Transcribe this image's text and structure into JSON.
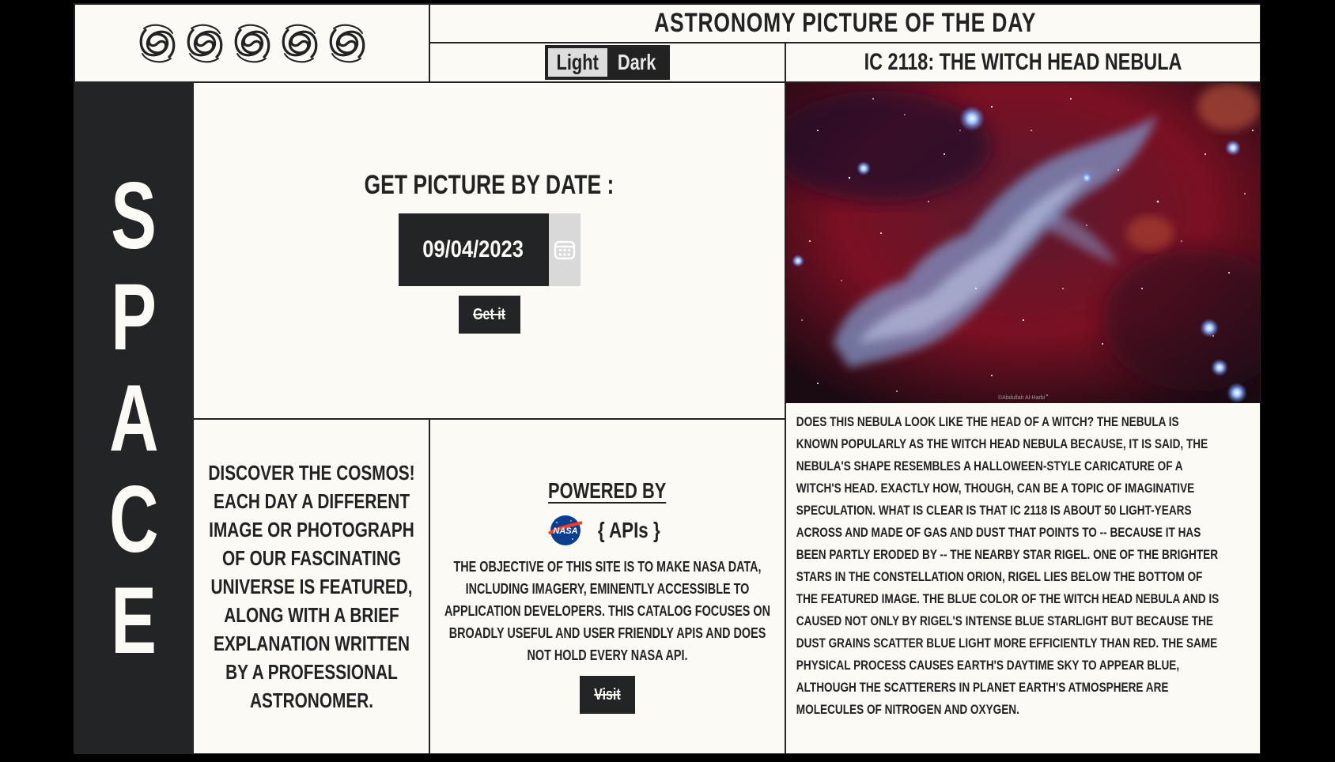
{
  "header": {
    "title": "Astronomy Picture of the Day",
    "logo_icons": [
      "galaxy-icon",
      "galaxy-icon",
      "galaxy-icon",
      "galaxy-icon",
      "galaxy-icon"
    ]
  },
  "theme_toggle": {
    "light_label": "Light",
    "dark_label": "Dark",
    "selected": "Light"
  },
  "picture": {
    "title": "IC 2118: The Witch Head Nebula",
    "credit": "©Abdullah Al-Harbi",
    "explanation": "Does this nebula look like the head of a witch? The nebula is known popularly as the Witch Head Nebula because, it is said, the nebula's shape resembles a Halloween-style caricature of a witch's head. Exactly how, though, can be a topic of imaginative speculation. What is clear is that IC 2118 is about 50 light-years across and made of gas and dust that points to -- because it has been partly eroded by -- the nearby star Rigel. One of the brighter stars in the constellation Orion, Rigel lies below the bottom of the featured image. The blue color of the Witch Head Nebula and is caused not only by Rigel's intense blue starlight but because the dust grains scatter blue light more efficiently than red. The same physical process causes Earth's daytime sky to appear blue, although the scatterers in planet Earth's atmosphere are molecules of nitrogen and oxygen."
  },
  "sidebar": {
    "letters": [
      "S",
      "P",
      "A",
      "C",
      "E"
    ]
  },
  "date_picker": {
    "label": "Get picture by date :",
    "value": "09/04/2023",
    "calendar_icon": "calendar-icon",
    "submit_label": "Get it"
  },
  "discover": {
    "text": "Discover the cosmos! Each day a different image or photograph of our fascinating universe is featured, along with a brief explanation written by a professional astronomer."
  },
  "powered": {
    "title": "Powered by",
    "logo_icon": "nasa-logo",
    "apis_label": "{ APIs }",
    "objective": "The objective of this site is to make NASA data, including imagery, eminently accessible to application developers. This catalog focuses on broadly useful and user friendly APIs and does not hold every NASA API.",
    "visit_label": "Visit"
  },
  "colors": {
    "background": "#fbfaf5",
    "dark": "#232425",
    "outer": "#000000"
  }
}
